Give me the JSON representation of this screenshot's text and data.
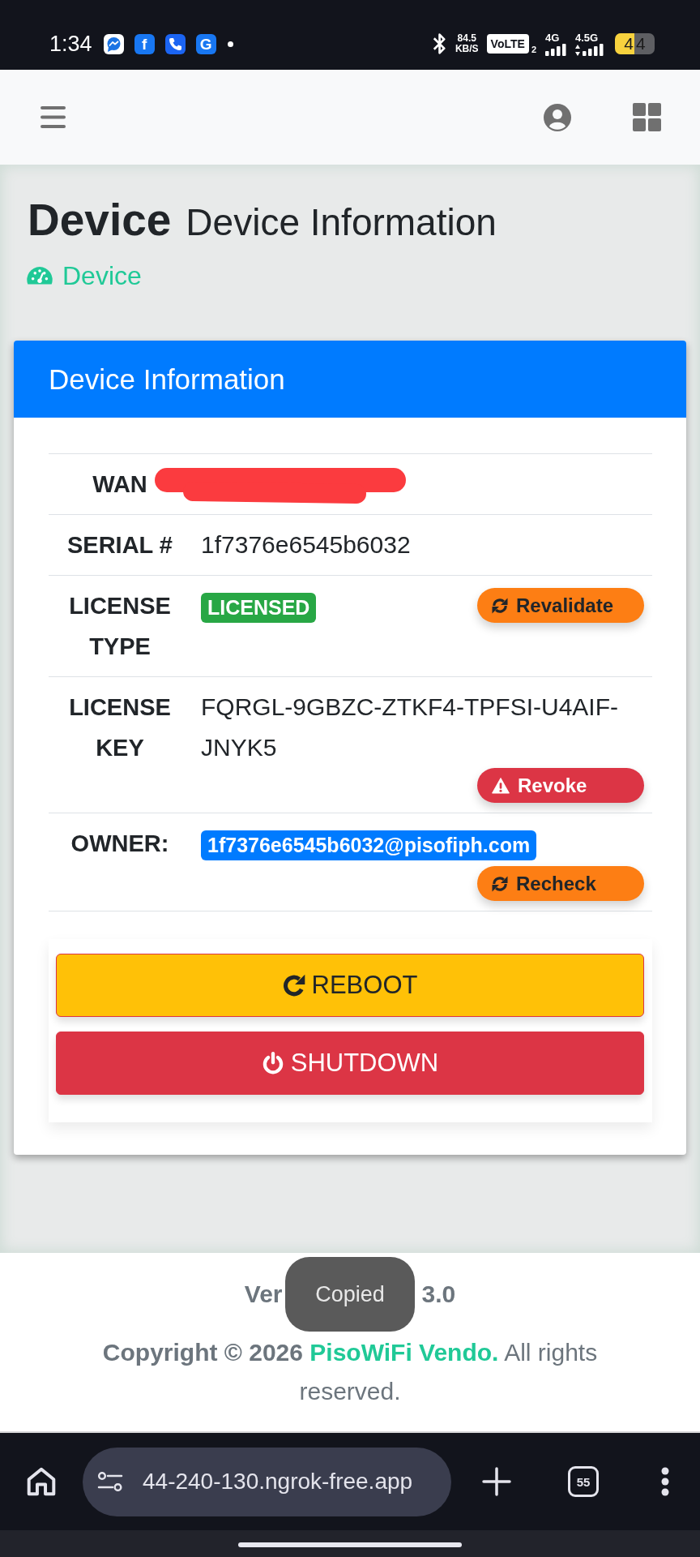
{
  "status_bar": {
    "time": "1:34",
    "notifications": [
      {
        "kind": "chat"
      },
      {
        "kind": "letter",
        "glyph": "f"
      },
      {
        "kind": "phone"
      },
      {
        "kind": "letter",
        "glyph": "G"
      }
    ],
    "speed": "84.5",
    "speed_unit": "KB/S",
    "volte": "VoLTE",
    "sim": "2",
    "networks": [
      {
        "label": "4G",
        "arrows": false
      },
      {
        "label": "4.5G",
        "arrows": true
      }
    ],
    "battery": "44"
  },
  "page_header": {
    "title": "Device",
    "subtitle": "Device Information",
    "breadcrumb": "Device"
  },
  "card": {
    "title": "Device Information",
    "rows": [
      {
        "label": "WAN",
        "kind": "redacted"
      },
      {
        "label": "SERIAL #",
        "kind": "text",
        "value": "1f7376e6545b6032"
      },
      {
        "label": "LICENSE TYPE",
        "kind": "badge",
        "value": "LICENSED",
        "color": "#28a745",
        "action": {
          "kind": "refresh",
          "label": "Revalidate"
        }
      },
      {
        "label": "LICENSE KEY",
        "kind": "text",
        "value": "FQRGL-9GBZC-ZTKF4-TPFSI-U4AIF-JNYK5",
        "action": {
          "kind": "danger",
          "label": "Revoke"
        }
      },
      {
        "label": "OWNER:",
        "kind": "badge",
        "value": "1f7376e6545b6032@pisofiph.com",
        "color": "#007bff",
        "action": {
          "kind": "refresh",
          "label": "Recheck"
        }
      }
    ],
    "buttons": [
      {
        "kind": "reboot",
        "label": "REBOOT"
      },
      {
        "kind": "shutdown",
        "label": "SHUTDOWN"
      }
    ]
  },
  "footer": {
    "version_visible": [
      "Ver",
      "3.0"
    ],
    "copyright": {
      "prefix": "Copyright © 2026",
      "link": "PisoWiFi Vendo.",
      "suffix": "All rights reserved."
    }
  },
  "toast": {
    "text": "Copied"
  },
  "browser_bar": {
    "url": "44-240-130.ngrok-free.app",
    "tab_count": "55"
  }
}
